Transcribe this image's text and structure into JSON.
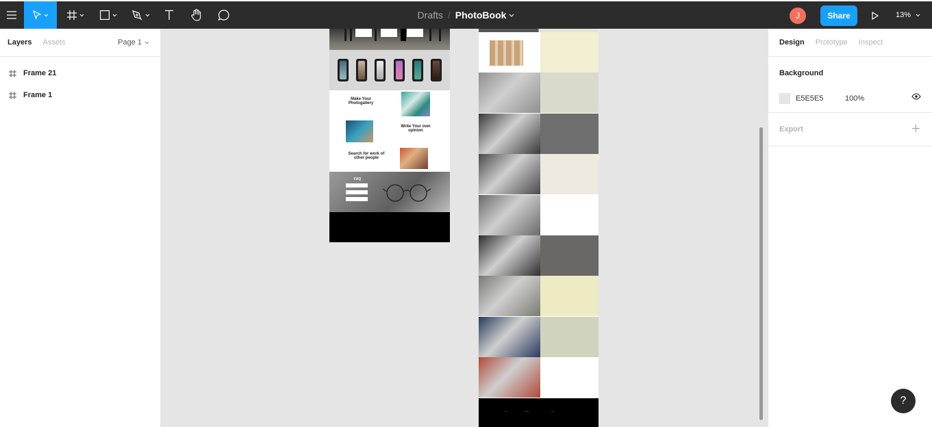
{
  "toolbar": {
    "breadcrumb_parent": "Drafts",
    "breadcrumb_separator": "/",
    "file_name": "PhotoBook",
    "avatar_initial": "J",
    "share_label": "Share",
    "zoom_level": "13%",
    "tools": [
      "menu-icon",
      "move-icon",
      "frame-icon",
      "shape-icon",
      "pen-icon",
      "text-icon",
      "hand-icon",
      "comment-icon"
    ],
    "accent_color": "#18a0fb",
    "avatar_color": "#f2715e"
  },
  "left_panel": {
    "tabs": [
      {
        "label": "Layers",
        "active": true
      },
      {
        "label": "Assets",
        "active": false
      }
    ],
    "page_selector": "Page 1",
    "layers": [
      {
        "name": "Frame 21"
      },
      {
        "name": "Frame 1"
      }
    ]
  },
  "right_panel": {
    "tabs": [
      {
        "label": "Design",
        "active": true
      },
      {
        "label": "Prototype",
        "active": false
      },
      {
        "label": "Inspect",
        "active": false
      }
    ],
    "background": {
      "heading": "Background",
      "hex": "E5E5E5",
      "opacity": "100%",
      "color": "#e5e5e5"
    },
    "export": {
      "heading": "Export"
    }
  },
  "canvas": {
    "background_color": "#e5e5e5",
    "frame21": {
      "gallery_texts": [
        "Make Your Photogallery",
        "Write Your own opinion",
        "Search for work of other people"
      ],
      "faq_title": "FAQ"
    },
    "frame1": {
      "rows": [
        {
          "photo": "#e8e2d4",
          "block": "#f2efd2"
        },
        {
          "photo": "#8f8f8f",
          "block": "#d9dacb"
        },
        {
          "photo": "#3a3a3a",
          "block": "#6e6e6e"
        },
        {
          "photo": "#4a4a4a",
          "block": "#eeeae0"
        },
        {
          "photo": "#6a6a6a",
          "block": "#ffffff"
        },
        {
          "photo": "#2f2f2f",
          "block": "#6b6766"
        },
        {
          "photo": "#7a7a74",
          "block": "#eeeac4"
        },
        {
          "photo": "#2a3a5e",
          "block": "#d0d3bd"
        },
        {
          "photo": "#b04a3a",
          "block": "#ffffff"
        }
      ]
    }
  },
  "help": {
    "label": "?"
  }
}
